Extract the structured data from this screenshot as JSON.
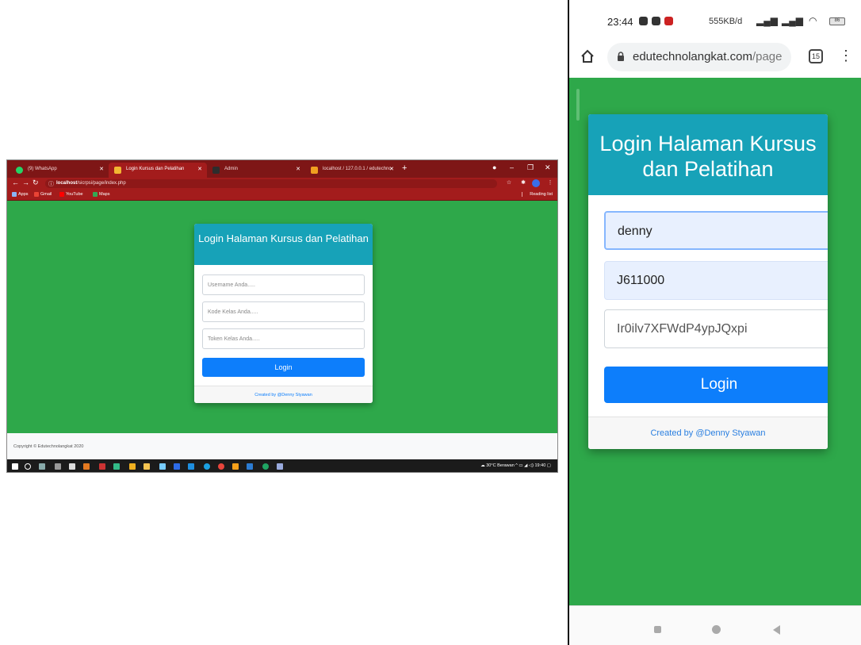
{
  "colors": {
    "page_green": "#2ea84a",
    "card_header": "#17a2b8",
    "button_blue": "#0d7efb",
    "browser_red": "#a31c1c"
  },
  "desktop": {
    "tabs": [
      {
        "label": "(9) WhatsApp",
        "icon": "whatsapp-icon"
      },
      {
        "label": "Login Kursus dan Pelatihan",
        "icon": "page-icon"
      },
      {
        "label": "Admin",
        "icon": "admin-icon"
      },
      {
        "label": "localhost / 127.0.0.1 / edutechno",
        "icon": "phpmyadmin-icon"
      }
    ],
    "url_host": "localhost",
    "url_path": "/sicrpsi/page/index.php",
    "bookmarks": [
      "Apps",
      "Gmail",
      "YouTube",
      "Maps"
    ],
    "reading_list": "Reading list",
    "login": {
      "title": "Login Halaman Kursus dan Pelatihan",
      "username_placeholder": "Username Anda.....",
      "kode_placeholder": "Kode Kelas Anda.....",
      "token_placeholder": "Token Kelas Anda.....",
      "button": "Login",
      "footer": "Created by @Denny Styawan"
    },
    "copyright": "Copyright © Edutechnolangkat 2020",
    "tray": {
      "weather": "30°C Berawan",
      "clock": "19:40"
    }
  },
  "phone": {
    "time": "23:44",
    "net_speed": "555KB/d",
    "battery": "86",
    "url_host": "edutechnolangkat.com",
    "url_path": "/page",
    "tab_count": "15",
    "login": {
      "title": "Login Halaman Kursus dan Pelatihan",
      "username_value": "denny",
      "kode_value": "J611000",
      "token_value": "Ir0ilv7XFWdP4ypJQxpi",
      "button": "Login",
      "footer": "Created by @Denny Styawan"
    }
  }
}
